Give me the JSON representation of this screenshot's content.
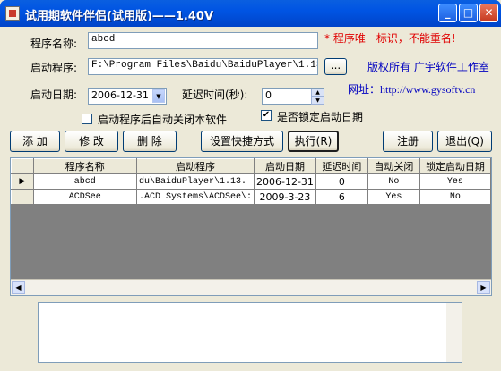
{
  "window": {
    "title": "试用期软件伴侣(试用版)——1.40V"
  },
  "title_buttons": {
    "minimize": "_",
    "maximize": "□",
    "close": "✕"
  },
  "form": {
    "name_label": "程序名称:",
    "name_value": "abcd",
    "name_hint": "* 程序唯一标识，不能重名!",
    "program_label": "启动程序:",
    "program_value": "F:\\Program Files\\Baidu\\BaiduPlayer\\1.13.0.",
    "browse_label": "...",
    "copyright": "版权所有 广宇软件工作室",
    "website": "网址：http://www.gysoftv.cn",
    "date_label": "启动日期:",
    "date_value": "2006-12-31",
    "delay_label": "延迟时间(秒):",
    "delay_value": "0",
    "auto_close_label": "启动程序后自动关闭本软件",
    "auto_close_checked": false,
    "lock_date_label": "是否锁定启动日期",
    "lock_date_checked": true
  },
  "buttons": {
    "add": "添 加",
    "edit": "修 改",
    "delete": "删 除",
    "shortcut": "设置快捷方式",
    "run": "执行(R)",
    "register": "注册",
    "exit": "退出(Q)"
  },
  "table": {
    "columns": [
      "程序名称",
      "启动程序",
      "启动日期",
      "延迟时间",
      "自动关闭",
      "锁定启动日期"
    ],
    "rows": [
      {
        "marker": "▶",
        "name": "abcd",
        "program": "du\\BaiduPlayer\\1.13.",
        "date": "2006-12-31",
        "delay": "0",
        "auto_close": "No",
        "lock": "Yes"
      },
      {
        "marker": "",
        "name": "ACDSee",
        "program": ".ACD Systems\\ACDSee\\:",
        "date": "2009-3-23",
        "delay": "6",
        "auto_close": "Yes",
        "lock": "No"
      }
    ]
  },
  "scroll_arrows": {
    "left": "◀",
    "right": "▶",
    "up": "▲",
    "down": "▼",
    "dropdown": "▼"
  },
  "memo": {
    "value": ""
  }
}
